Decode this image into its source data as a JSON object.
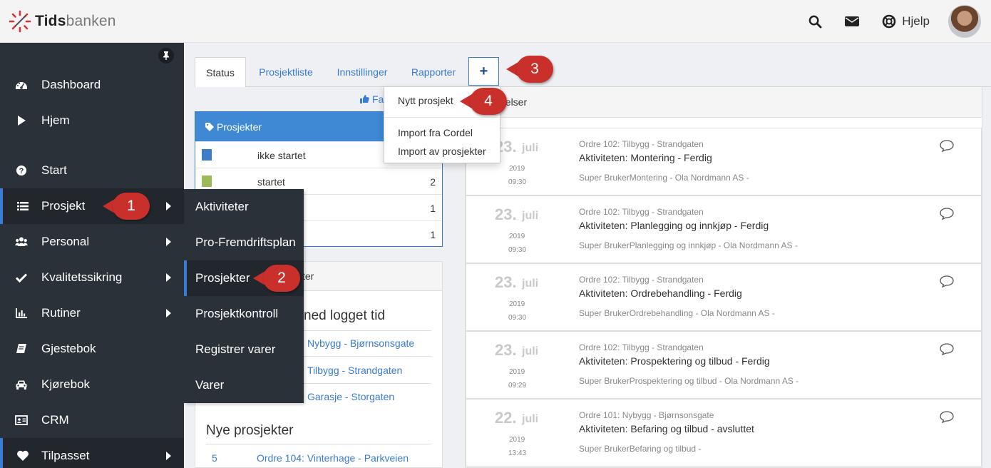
{
  "app": {
    "brand_bold": "Tids",
    "brand_rest": "banken",
    "help_label": "Hjelp"
  },
  "sidebar": {
    "items": [
      {
        "label": "Dashboard",
        "icon": "dashboard-icon"
      },
      {
        "label": "Hjem",
        "icon": "play-icon"
      },
      {
        "label": "Start",
        "icon": "question-circle-icon"
      },
      {
        "label": "Prosjekt",
        "icon": "list-icon"
      },
      {
        "label": "Personal",
        "icon": "users-icon"
      },
      {
        "label": "Kvalitetssikring",
        "icon": "check-icon"
      },
      {
        "label": "Rutiner",
        "icon": "bar-chart-icon"
      },
      {
        "label": "Gjestebok",
        "icon": "book-icon"
      },
      {
        "label": "Kjørebok",
        "icon": "car-icon"
      },
      {
        "label": "CRM",
        "icon": "contact-card-icon"
      },
      {
        "label": "Tilpasset",
        "icon": "heart-icon"
      }
    ]
  },
  "submenu": {
    "items": [
      "Aktiviteter",
      "Pro-Fremdriftsplan",
      "Prosjekter",
      "Prosjektkontroll",
      "Registrer varer",
      "Varer"
    ]
  },
  "tabs": [
    "Status",
    "Prosjektliste",
    "Innstillinger",
    "Rapporter",
    "+"
  ],
  "dropdown": {
    "items": [
      "Nytt prosjekt",
      "Import fra Cordel",
      "Import av prosjekter"
    ]
  },
  "favorite_label": "Fa",
  "projects_panel": {
    "title": "Prosjekter",
    "rows": [
      {
        "label": "ikke startet",
        "count": "",
        "color": "#3d7cc9"
      },
      {
        "label": "startet",
        "count": "2",
        "color": "#9bbb59"
      },
      {
        "label": "",
        "count": "1",
        "color": ""
      },
      {
        "label": "",
        "count": "1",
        "color": ""
      }
    ]
  },
  "list_panel": {
    "head_fragment": "ter",
    "section1_title_fragment": "ned logget tid",
    "logged": [
      "Nybygg - Bjørnsonsgate",
      "Tilbygg - Strandgaten",
      "Garasje - Storgaten"
    ],
    "section2_title": "Nye prosjekter",
    "new_project": {
      "number": "5",
      "name": "Ordre 104: Vinterhage - Parkveien"
    }
  },
  "feed": {
    "head_fragment": "delser",
    "items": [
      {
        "day": "23.",
        "month": "juli",
        "year": "2019",
        "time": "09:30",
        "order": "Ordre 102: Tilbygg - Strandgaten",
        "activity": "Aktiviteten: Montering - Ferdig",
        "user": "Super BrukerMontering - Ola Nordmann AS -"
      },
      {
        "day": "23.",
        "month": "juli",
        "year": "2019",
        "time": "09:30",
        "order": "Ordre 102: Tilbygg - Strandgaten",
        "activity": "Aktiviteten: Planlegging og innkjøp - Ferdig",
        "user": "Super BrukerPlanlegging og innkjøp - Ola Nordmann AS -"
      },
      {
        "day": "23.",
        "month": "juli",
        "year": "2019",
        "time": "09:30",
        "order": "Ordre 102: Tilbygg - Strandgaten",
        "activity": "Aktiviteten: Ordrebehandling - Ferdig",
        "user": "Super BrukerOrdrebehandling - Ola Nordmann AS -"
      },
      {
        "day": "23.",
        "month": "juli",
        "year": "2019",
        "time": "09:29",
        "order": "Ordre 102: Tilbygg - Strandgaten",
        "activity": "Aktiviteten: Prospektering og tilbud - Ferdig",
        "user": "Super BrukerProspektering og tilbud - Ola Nordmann AS -"
      },
      {
        "day": "22.",
        "month": "juli",
        "year": "2019",
        "time": "13:43",
        "order": "Ordre 101: Nybygg - Bjørnsonsgate",
        "activity": "Aktiviteten: Befaring og tilbud - avsluttet",
        "user": "Super BrukerBefaring og tilbud -"
      }
    ]
  },
  "callouts": [
    "1",
    "2",
    "3",
    "4"
  ]
}
